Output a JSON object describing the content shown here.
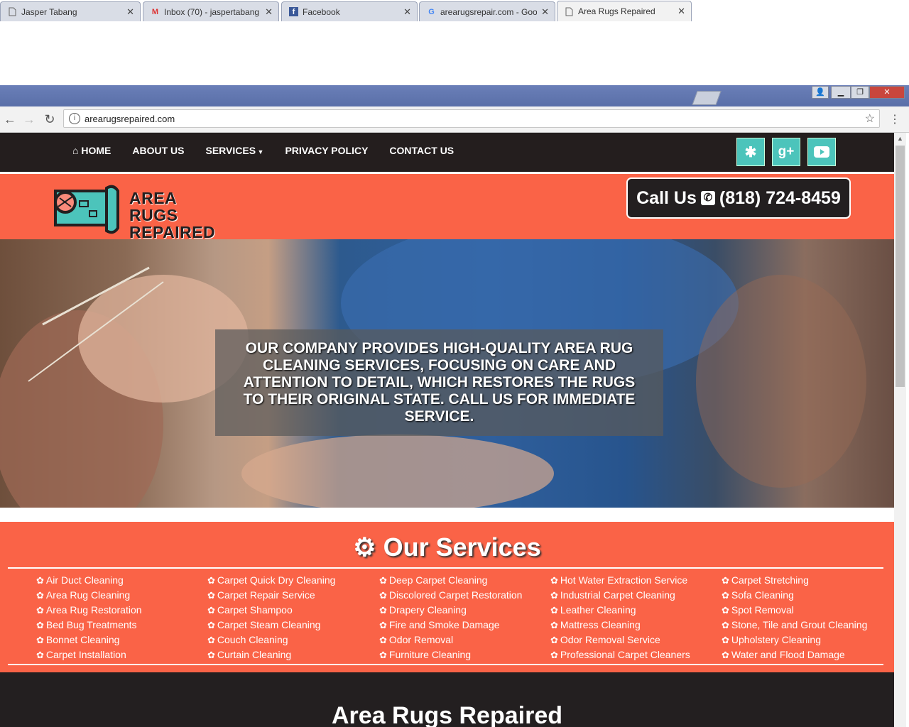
{
  "browser": {
    "tabs": [
      {
        "title": "Jasper Tabang",
        "icon": "page-icon"
      },
      {
        "title": "Inbox (70) - jaspertabang",
        "icon": "gmail-icon"
      },
      {
        "title": "Facebook",
        "icon": "facebook-icon"
      },
      {
        "title": "arearugsrepair.com - Goo",
        "icon": "google-icon"
      },
      {
        "title": "Area Rugs Repaired",
        "icon": "page-icon"
      }
    ],
    "url": "arearugsrepaired.com"
  },
  "nav": {
    "items": [
      "HOME",
      "ABOUT US",
      "SERVICES",
      "PRIVACY POLICY",
      "CONTACT US"
    ],
    "social": [
      "yelp-icon",
      "google-plus-icon",
      "youtube-icon"
    ]
  },
  "brand": {
    "line1": "AREA RUGS",
    "line2": "REPAIRED",
    "call_label": "Call Us",
    "phone": "(818) 724-8459"
  },
  "hero": {
    "text": "OUR COMPANY PROVIDES HIGH-QUALITY AREA RUG CLEANING SERVICES, FOCUSING ON CARE AND ATTENTION TO DETAIL, WHICH RESTORES THE RUGS TO THEIR ORIGINAL STATE. CALL US FOR IMMEDIATE SERVICE."
  },
  "services": {
    "title": "Our Services",
    "columns": [
      [
        "Air Duct Cleaning",
        "Area Rug Cleaning",
        "Area Rug Restoration",
        "Bed Bug Treatments",
        "Bonnet Cleaning",
        "Carpet Installation"
      ],
      [
        "Carpet Quick Dry Cleaning",
        "Carpet Repair Service",
        "Carpet Shampoo",
        "Carpet Steam Cleaning",
        "Couch Cleaning",
        "Curtain Cleaning"
      ],
      [
        "Deep Carpet Cleaning",
        "Discolored Carpet Restoration",
        "Drapery Cleaning",
        "Fire and Smoke Damage",
        "Odor Removal",
        "Furniture Cleaning"
      ],
      [
        "Hot Water Extraction Service",
        "Industrial Carpet Cleaning",
        "Leather Cleaning",
        "Mattress Cleaning",
        "Odor Removal Service",
        "Professional Carpet Cleaners"
      ],
      [
        "Carpet Stretching",
        "Sofa Cleaning",
        "Spot Removal",
        "Stone, Tile and Grout Cleaning",
        "Upholstery Cleaning",
        "Water and Flood Damage"
      ]
    ]
  },
  "footer_heading": "Area Rugs Repaired",
  "colors": {
    "accent": "#fa6347",
    "dark": "#231f20",
    "social": "#4cc4bb"
  }
}
